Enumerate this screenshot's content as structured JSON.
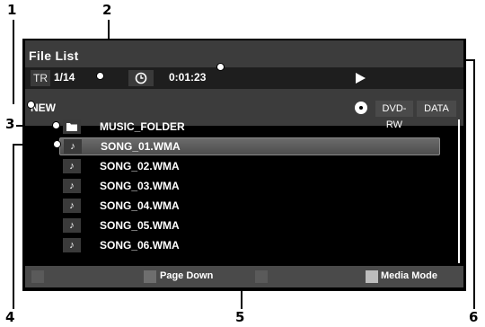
{
  "callouts": {
    "c1": "1",
    "c2": "2",
    "c3": "3",
    "c4": "4",
    "c5": "5",
    "c6": "6"
  },
  "header": {
    "title": "File List",
    "track_prefix": "TR",
    "track_number": "1/14",
    "clock_icon": "clock-icon",
    "elapsed_time": "0:01:23",
    "play_icon": "play-icon"
  },
  "folder_bar": {
    "current_folder": "NEW",
    "disc_icon": "disc-icon",
    "disc_type": "DVD-RW",
    "mode": "DATA"
  },
  "items": [
    {
      "icon": "folder-icon",
      "label": "MUSIC_FOLDER",
      "selected": false
    },
    {
      "icon": "music-note-icon",
      "label": "SONG_01.WMA",
      "selected": true
    },
    {
      "icon": "music-note-icon",
      "label": "SONG_02.WMA",
      "selected": false
    },
    {
      "icon": "music-note-icon",
      "label": "SONG_03.WMA",
      "selected": false
    },
    {
      "icon": "music-note-icon",
      "label": "SONG_04.WMA",
      "selected": false
    },
    {
      "icon": "music-note-icon",
      "label": "SONG_05.WMA",
      "selected": false
    },
    {
      "icon": "music-note-icon",
      "label": "SONG_06.WMA",
      "selected": false
    }
  ],
  "footer": {
    "keys": [
      {
        "color": "#5a5a5a",
        "label": ""
      },
      {
        "color": "#6e6e6e",
        "label": "Page Down"
      },
      {
        "color": "#5a5a5a",
        "label": ""
      },
      {
        "color": "#bdbdbd",
        "label": "Media Mode"
      }
    ]
  },
  "colors": {
    "screen_bg": "#000000",
    "header_bg": "#3c3c3c",
    "footer_bg": "#4a4a4a",
    "selection": "#5c5c5c"
  }
}
